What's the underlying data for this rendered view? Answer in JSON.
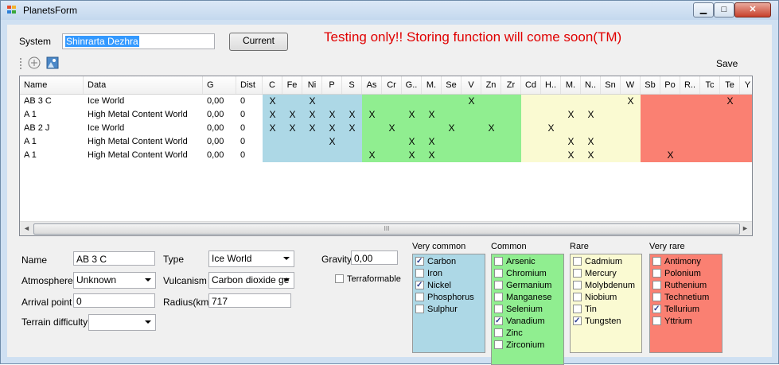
{
  "window": {
    "title": "PlanetsForm",
    "min_glyph": "▁",
    "max_glyph": "□",
    "close_glyph": "✕"
  },
  "colors": {
    "very_common": "#add8e6",
    "common": "#90ee90",
    "rare": "#fafad2",
    "very_rare": "#fa8072",
    "warning": "#e00000"
  },
  "system": {
    "label": "System",
    "value": "Shinrarta Dezhra",
    "current_button": "Current"
  },
  "warning_text": "Testing only!!  Storing function will come soon(TM)",
  "toolbar": {
    "add_icon": "add-icon",
    "image_icon": "image-icon",
    "save_label": "Save"
  },
  "grid": {
    "columns": [
      "Name",
      "Data",
      "G",
      "Dist",
      "C",
      "Fe",
      "Ni",
      "P",
      "S",
      "As",
      "Cr",
      "G..",
      "M.",
      "Se",
      "V",
      "Zn",
      "Zr",
      "Cd",
      "H..",
      "M.",
      "N..",
      "Sn",
      "W",
      "Sb",
      "Po",
      "R..",
      "Tc",
      "Te",
      "Y"
    ],
    "rows": [
      {
        "name": "AB 3 C",
        "data": "Ice World",
        "g": "0,00",
        "dist": "0",
        "marks": [
          "X",
          "",
          "X",
          "",
          "",
          "",
          "",
          "",
          "",
          "",
          "X",
          "",
          "",
          "",
          "",
          "",
          "",
          "",
          "X",
          "",
          "",
          "",
          "",
          "X",
          ""
        ]
      },
      {
        "name": "A 1",
        "data": "High Metal Content World",
        "g": "0,00",
        "dist": "0",
        "marks": [
          "X",
          "X",
          "X",
          "X",
          "X",
          "X",
          "",
          "X",
          "X",
          "",
          "",
          "",
          "",
          "",
          "",
          "X",
          "X",
          "",
          "",
          "",
          "",
          "",
          "",
          "",
          ""
        ]
      },
      {
        "name": "AB 2 J",
        "data": "Ice World",
        "g": "0,00",
        "dist": "0",
        "marks": [
          "X",
          "X",
          "X",
          "X",
          "X",
          "",
          "X",
          "",
          "",
          "X",
          "",
          "X",
          "",
          "",
          "X",
          "",
          "",
          "",
          "",
          "",
          "",
          "",
          "",
          "",
          ""
        ]
      },
      {
        "name": "A 1",
        "data": "High Metal Content World",
        "g": "0,00",
        "dist": "0",
        "marks": [
          "",
          "",
          "",
          "X",
          "",
          "",
          "",
          "X",
          "X",
          "",
          "",
          "",
          "",
          "",
          "",
          "X",
          "X",
          "",
          "",
          "",
          "",
          "",
          "",
          "",
          ""
        ]
      },
      {
        "name": "A 1",
        "data": "High Metal Content World",
        "g": "0,00",
        "dist": "0",
        "marks": [
          "",
          "",
          "",
          "",
          "",
          "X",
          "",
          "X",
          "X",
          "",
          "",
          "",
          "",
          "",
          "",
          "X",
          "X",
          "",
          "",
          "",
          "X",
          "",
          "",
          "",
          ""
        ]
      }
    ],
    "scroll_left": "◄",
    "scroll_right": "►",
    "scroll_grip": "III"
  },
  "details": {
    "name_label": "Name",
    "name_value": "AB 3 C",
    "atmosphere_label": "Atmosphere",
    "atmosphere_value": "Unknown",
    "arrival_label": "Arrival point",
    "arrival_value": "0",
    "terrain_label": "Terrain difficulty",
    "terrain_value": "",
    "type_label": "Type",
    "type_value": "Ice World",
    "vulcanism_label": "Vulcanism",
    "vulcanism_value": "Carbon dioxide ge",
    "radius_label": "Radius(km)",
    "radius_value": "717",
    "gravity_label": "Gravity",
    "gravity_value": "0,00",
    "terraformable_label": "Terraformable",
    "terraformable_checked": false
  },
  "groups": [
    {
      "title": "Very common",
      "items": [
        {
          "label": "Carbon",
          "checked": true
        },
        {
          "label": "Iron",
          "checked": false
        },
        {
          "label": "Nickel",
          "checked": true
        },
        {
          "label": "Phosphorus",
          "checked": false
        },
        {
          "label": "Sulphur",
          "checked": false
        }
      ]
    },
    {
      "title": "Common",
      "items": [
        {
          "label": "Arsenic",
          "checked": false
        },
        {
          "label": "Chromium",
          "checked": false
        },
        {
          "label": "Germanium",
          "checked": false
        },
        {
          "label": "Manganese",
          "checked": false
        },
        {
          "label": "Selenium",
          "checked": false
        },
        {
          "label": "Vanadium",
          "checked": true
        },
        {
          "label": "Zinc",
          "checked": false
        },
        {
          "label": "Zirconium",
          "checked": false
        }
      ]
    },
    {
      "title": "Rare",
      "items": [
        {
          "label": "Cadmium",
          "checked": false
        },
        {
          "label": "Mercury",
          "checked": false
        },
        {
          "label": "Molybdenum",
          "checked": false
        },
        {
          "label": "Niobium",
          "checked": false
        },
        {
          "label": "Tin",
          "checked": false
        },
        {
          "label": "Tungsten",
          "checked": true
        }
      ]
    },
    {
      "title": "Very rare",
      "items": [
        {
          "label": "Antimony",
          "checked": false
        },
        {
          "label": "Polonium",
          "checked": false
        },
        {
          "label": "Ruthenium",
          "checked": false
        },
        {
          "label": "Technetium",
          "checked": false
        },
        {
          "label": "Tellurium",
          "checked": true
        },
        {
          "label": "Yttrium",
          "checked": false
        }
      ]
    }
  ]
}
